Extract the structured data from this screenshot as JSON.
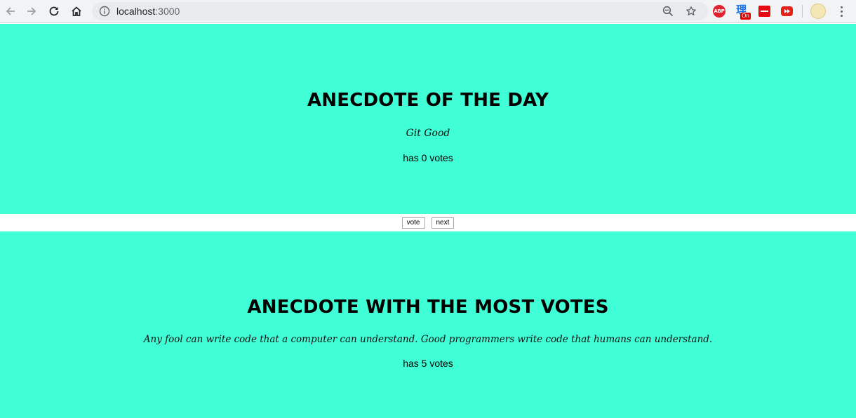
{
  "browser": {
    "url_host": "localhost",
    "url_port": ":3000",
    "extensions": {
      "abp_label": "ABP",
      "li_glyph": "理",
      "li_badge": "On"
    },
    "colors": {
      "toolbar": "#f1f3f4",
      "omnibox": "#e8eaed"
    }
  },
  "page": {
    "background": "#40ffd6",
    "anecdote_of_day": {
      "heading": "ANECDOTE OF THE DAY",
      "text": "Git Good",
      "votes": "has 0 votes"
    },
    "controls": {
      "vote_label": "vote",
      "next_label": "next"
    },
    "most_votes": {
      "heading": "ANECDOTE WITH THE MOST VOTES",
      "text": "Any fool can write code that a computer can understand. Good programmers write code that humans can understand.",
      "votes": "has 5 votes"
    }
  }
}
